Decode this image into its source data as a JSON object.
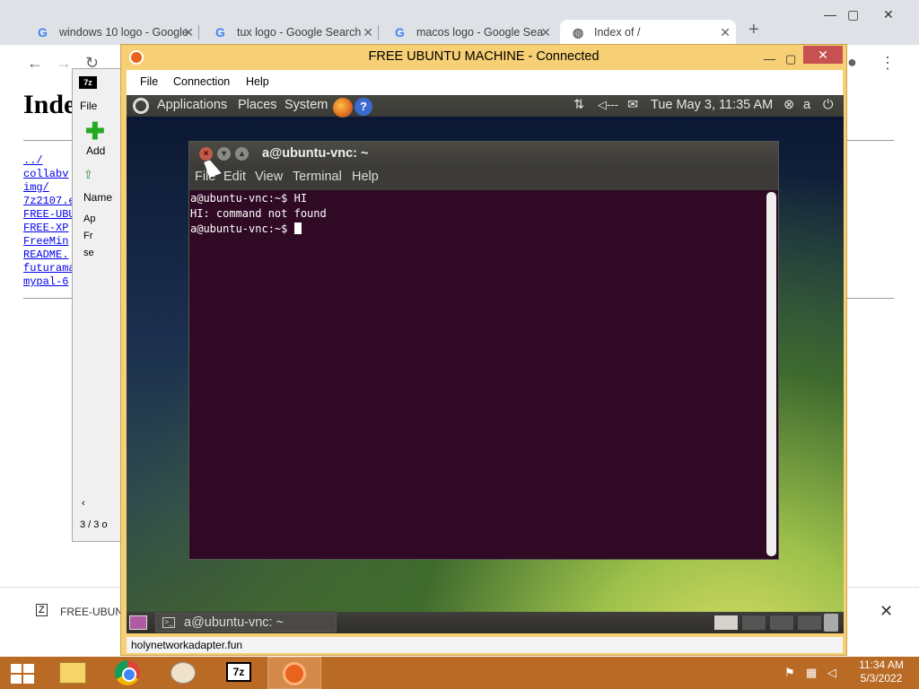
{
  "browser": {
    "tabs": [
      {
        "label": "windows 10 logo - Google",
        "icon": "google-g"
      },
      {
        "label": "tux logo - Google Search",
        "icon": "google-g"
      },
      {
        "label": "macos logo - Google Sea",
        "icon": "google-g"
      },
      {
        "label": "Index of /",
        "icon": "globe"
      }
    ],
    "page_heading": "Index of /",
    "links": [
      "../",
      "collabv",
      "img/",
      "7z2107.e",
      "FREE-UBU",
      "FREE-XP",
      "FreeMin",
      "README.",
      "futurama",
      "mypal-6"
    ],
    "download_item": "FREE-UBUN"
  },
  "sevenzip": {
    "menu_file": "File",
    "add_label": "Add",
    "col_name": "Name",
    "rows": [
      "Ap",
      "Fr",
      "se"
    ],
    "status": "3 / 3 o"
  },
  "vnc": {
    "title": "FREE UBUNTU MACHINE - Connected",
    "menu": [
      "File",
      "Connection",
      "Help"
    ],
    "status_url": "holynetworkadapter.fun"
  },
  "ubuntu": {
    "top_menu": [
      "Applications",
      "Places",
      "System"
    ],
    "datetime": "Tue May  3, 11:35 AM",
    "user": "a",
    "terminal": {
      "title": "a@ubuntu-vnc: ~",
      "menu": [
        "File",
        "Edit",
        "View",
        "Terminal",
        "Help"
      ],
      "lines": [
        "a@ubuntu-vnc:~$ HI",
        "HI: command not found",
        "a@ubuntu-vnc:~$ "
      ]
    },
    "taskbar_item": "a@ubuntu-vnc: ~"
  },
  "windows": {
    "clock_time": "11:34 AM",
    "clock_date": "5/3/2022"
  }
}
